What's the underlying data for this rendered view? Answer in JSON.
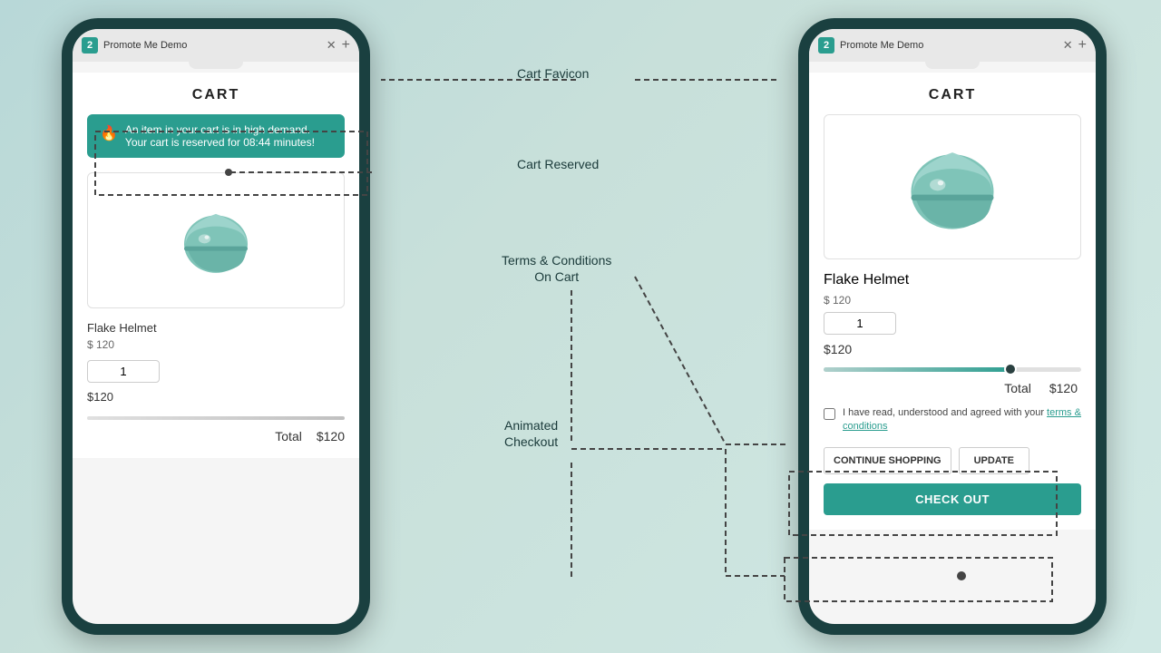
{
  "left_phone": {
    "tab_number": "2",
    "tab_title": "Promote Me Demo",
    "cart_heading": "CART",
    "alert": {
      "icon": "🔥",
      "line1": "An item in your cart is in high demand.",
      "line2_prefix": "Your cart is reserved for ",
      "timer": "08:44",
      "line2_suffix": " minutes!"
    },
    "product": {
      "name": "Flake Helmet",
      "price": "$ 120",
      "qty": "1",
      "line_total": "$120"
    },
    "total_label": "Total",
    "total_value": "$120"
  },
  "right_phone": {
    "tab_number": "2",
    "tab_title": "Promote Me Demo",
    "cart_heading": "CART",
    "product": {
      "name": "Flake Helmet",
      "price": "$ 120",
      "qty": "1",
      "subtotal": "$120"
    },
    "total_label": "Total",
    "total_value": "$120",
    "terms_text": "I have read, understood and agreed with your ",
    "terms_link": "terms & conditions",
    "btn_continue": "CONTINUE SHOPPING",
    "btn_update": "UPDATE",
    "btn_checkout": "CHECK OUT"
  },
  "annotations": {
    "cart_favicon": "Cart Favicon",
    "cart_reserved": "Cart Reserved",
    "terms_conditions": "Terms & Conditions\nOn Cart",
    "animated_checkout": "Animated\nCheckout"
  }
}
